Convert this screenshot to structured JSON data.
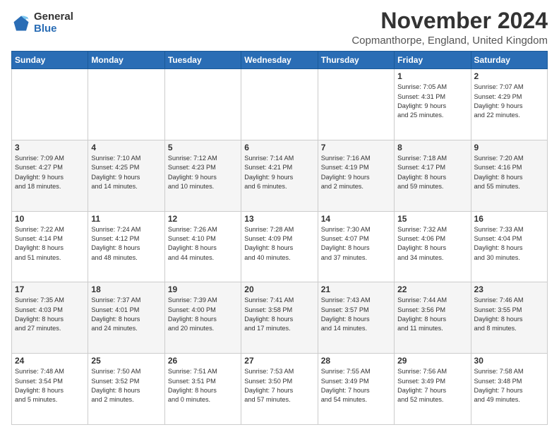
{
  "header": {
    "logo_general": "General",
    "logo_blue": "Blue",
    "month_title": "November 2024",
    "subtitle": "Copmanthorpe, England, United Kingdom"
  },
  "weekdays": [
    "Sunday",
    "Monday",
    "Tuesday",
    "Wednesday",
    "Thursday",
    "Friday",
    "Saturday"
  ],
  "weeks": [
    [
      {
        "day": "",
        "info": ""
      },
      {
        "day": "",
        "info": ""
      },
      {
        "day": "",
        "info": ""
      },
      {
        "day": "",
        "info": ""
      },
      {
        "day": "",
        "info": ""
      },
      {
        "day": "1",
        "info": "Sunrise: 7:05 AM\nSunset: 4:31 PM\nDaylight: 9 hours\nand 25 minutes."
      },
      {
        "day": "2",
        "info": "Sunrise: 7:07 AM\nSunset: 4:29 PM\nDaylight: 9 hours\nand 22 minutes."
      }
    ],
    [
      {
        "day": "3",
        "info": "Sunrise: 7:09 AM\nSunset: 4:27 PM\nDaylight: 9 hours\nand 18 minutes."
      },
      {
        "day": "4",
        "info": "Sunrise: 7:10 AM\nSunset: 4:25 PM\nDaylight: 9 hours\nand 14 minutes."
      },
      {
        "day": "5",
        "info": "Sunrise: 7:12 AM\nSunset: 4:23 PM\nDaylight: 9 hours\nand 10 minutes."
      },
      {
        "day": "6",
        "info": "Sunrise: 7:14 AM\nSunset: 4:21 PM\nDaylight: 9 hours\nand 6 minutes."
      },
      {
        "day": "7",
        "info": "Sunrise: 7:16 AM\nSunset: 4:19 PM\nDaylight: 9 hours\nand 2 minutes."
      },
      {
        "day": "8",
        "info": "Sunrise: 7:18 AM\nSunset: 4:17 PM\nDaylight: 8 hours\nand 59 minutes."
      },
      {
        "day": "9",
        "info": "Sunrise: 7:20 AM\nSunset: 4:16 PM\nDaylight: 8 hours\nand 55 minutes."
      }
    ],
    [
      {
        "day": "10",
        "info": "Sunrise: 7:22 AM\nSunset: 4:14 PM\nDaylight: 8 hours\nand 51 minutes."
      },
      {
        "day": "11",
        "info": "Sunrise: 7:24 AM\nSunset: 4:12 PM\nDaylight: 8 hours\nand 48 minutes."
      },
      {
        "day": "12",
        "info": "Sunrise: 7:26 AM\nSunset: 4:10 PM\nDaylight: 8 hours\nand 44 minutes."
      },
      {
        "day": "13",
        "info": "Sunrise: 7:28 AM\nSunset: 4:09 PM\nDaylight: 8 hours\nand 40 minutes."
      },
      {
        "day": "14",
        "info": "Sunrise: 7:30 AM\nSunset: 4:07 PM\nDaylight: 8 hours\nand 37 minutes."
      },
      {
        "day": "15",
        "info": "Sunrise: 7:32 AM\nSunset: 4:06 PM\nDaylight: 8 hours\nand 34 minutes."
      },
      {
        "day": "16",
        "info": "Sunrise: 7:33 AM\nSunset: 4:04 PM\nDaylight: 8 hours\nand 30 minutes."
      }
    ],
    [
      {
        "day": "17",
        "info": "Sunrise: 7:35 AM\nSunset: 4:03 PM\nDaylight: 8 hours\nand 27 minutes."
      },
      {
        "day": "18",
        "info": "Sunrise: 7:37 AM\nSunset: 4:01 PM\nDaylight: 8 hours\nand 24 minutes."
      },
      {
        "day": "19",
        "info": "Sunrise: 7:39 AM\nSunset: 4:00 PM\nDaylight: 8 hours\nand 20 minutes."
      },
      {
        "day": "20",
        "info": "Sunrise: 7:41 AM\nSunset: 3:58 PM\nDaylight: 8 hours\nand 17 minutes."
      },
      {
        "day": "21",
        "info": "Sunrise: 7:43 AM\nSunset: 3:57 PM\nDaylight: 8 hours\nand 14 minutes."
      },
      {
        "day": "22",
        "info": "Sunrise: 7:44 AM\nSunset: 3:56 PM\nDaylight: 8 hours\nand 11 minutes."
      },
      {
        "day": "23",
        "info": "Sunrise: 7:46 AM\nSunset: 3:55 PM\nDaylight: 8 hours\nand 8 minutes."
      }
    ],
    [
      {
        "day": "24",
        "info": "Sunrise: 7:48 AM\nSunset: 3:54 PM\nDaylight: 8 hours\nand 5 minutes."
      },
      {
        "day": "25",
        "info": "Sunrise: 7:50 AM\nSunset: 3:52 PM\nDaylight: 8 hours\nand 2 minutes."
      },
      {
        "day": "26",
        "info": "Sunrise: 7:51 AM\nSunset: 3:51 PM\nDaylight: 8 hours\nand 0 minutes."
      },
      {
        "day": "27",
        "info": "Sunrise: 7:53 AM\nSunset: 3:50 PM\nDaylight: 7 hours\nand 57 minutes."
      },
      {
        "day": "28",
        "info": "Sunrise: 7:55 AM\nSunset: 3:49 PM\nDaylight: 7 hours\nand 54 minutes."
      },
      {
        "day": "29",
        "info": "Sunrise: 7:56 AM\nSunset: 3:49 PM\nDaylight: 7 hours\nand 52 minutes."
      },
      {
        "day": "30",
        "info": "Sunrise: 7:58 AM\nSunset: 3:48 PM\nDaylight: 7 hours\nand 49 minutes."
      }
    ]
  ]
}
